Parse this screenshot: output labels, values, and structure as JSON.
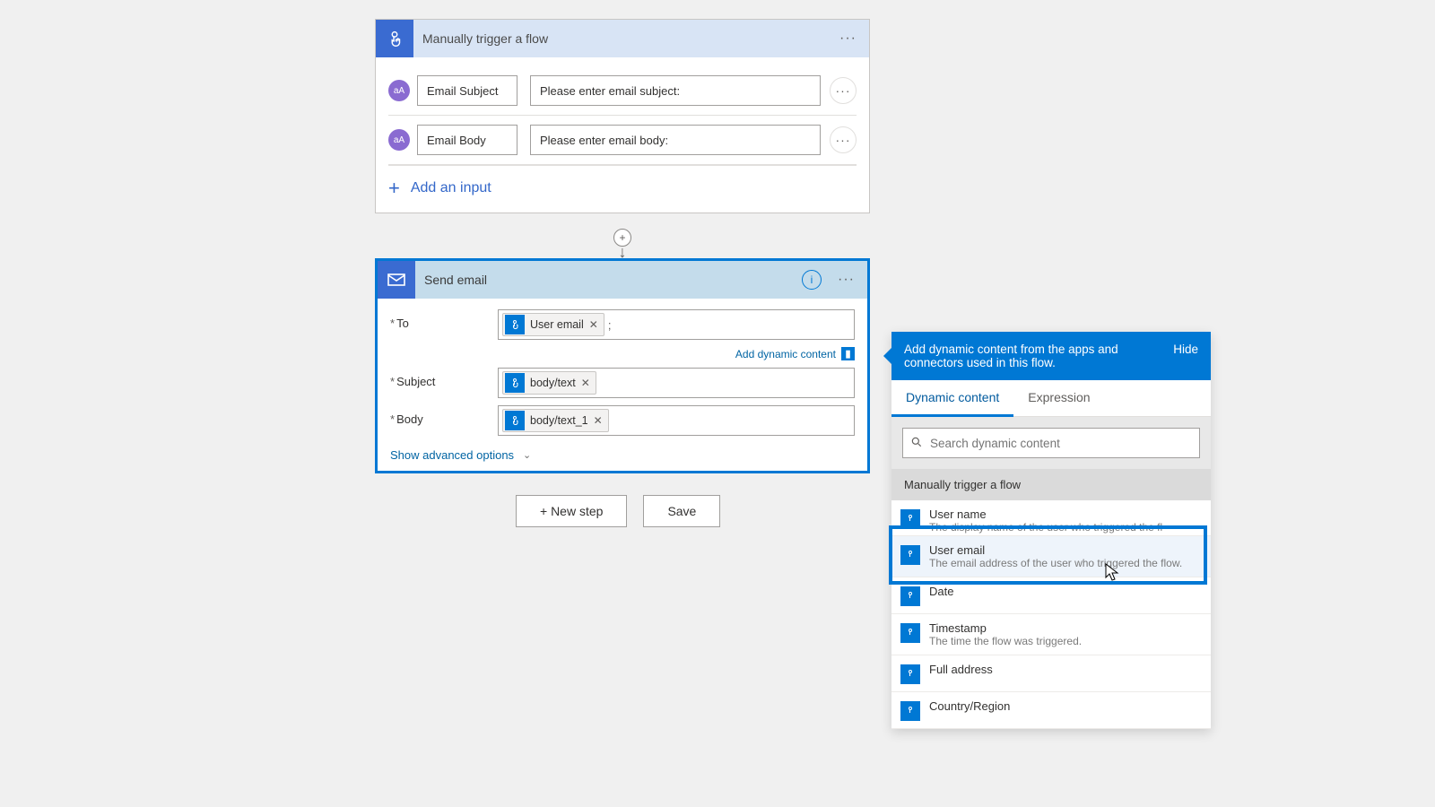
{
  "trigger": {
    "title": "Manually trigger a flow",
    "inputs": [
      {
        "name": "Email Subject",
        "value": "Please enter email subject:"
      },
      {
        "name": "Email Body",
        "value": "Please enter email body:"
      }
    ],
    "add_input": "Add an input"
  },
  "action": {
    "title": "Send email",
    "fields": {
      "to": {
        "label": "To",
        "token": "User email"
      },
      "subject": {
        "label": "Subject",
        "token": "body/text"
      },
      "body": {
        "label": "Body",
        "token": "body/text_1"
      }
    },
    "add_dynamic": "Add dynamic content",
    "show_advanced": "Show advanced options"
  },
  "buttons": {
    "new_step": "+ New step",
    "save": "Save"
  },
  "dynamic_panel": {
    "header_text": "Add dynamic content from the apps and connectors used in this flow.",
    "hide": "Hide",
    "tabs": {
      "dynamic": "Dynamic content",
      "expression": "Expression"
    },
    "search_placeholder": "Search dynamic content",
    "section": "Manually trigger a flow",
    "items": [
      {
        "title": "User name",
        "desc": "The display name of the user who triggered the flow"
      },
      {
        "title": "User email",
        "desc": "The email address of the user who triggered the flow."
      },
      {
        "title": "Date",
        "desc": ""
      },
      {
        "title": "Timestamp",
        "desc": "The time the flow was triggered."
      },
      {
        "title": "Full address",
        "desc": ""
      },
      {
        "title": "Country/Region",
        "desc": ""
      }
    ]
  }
}
